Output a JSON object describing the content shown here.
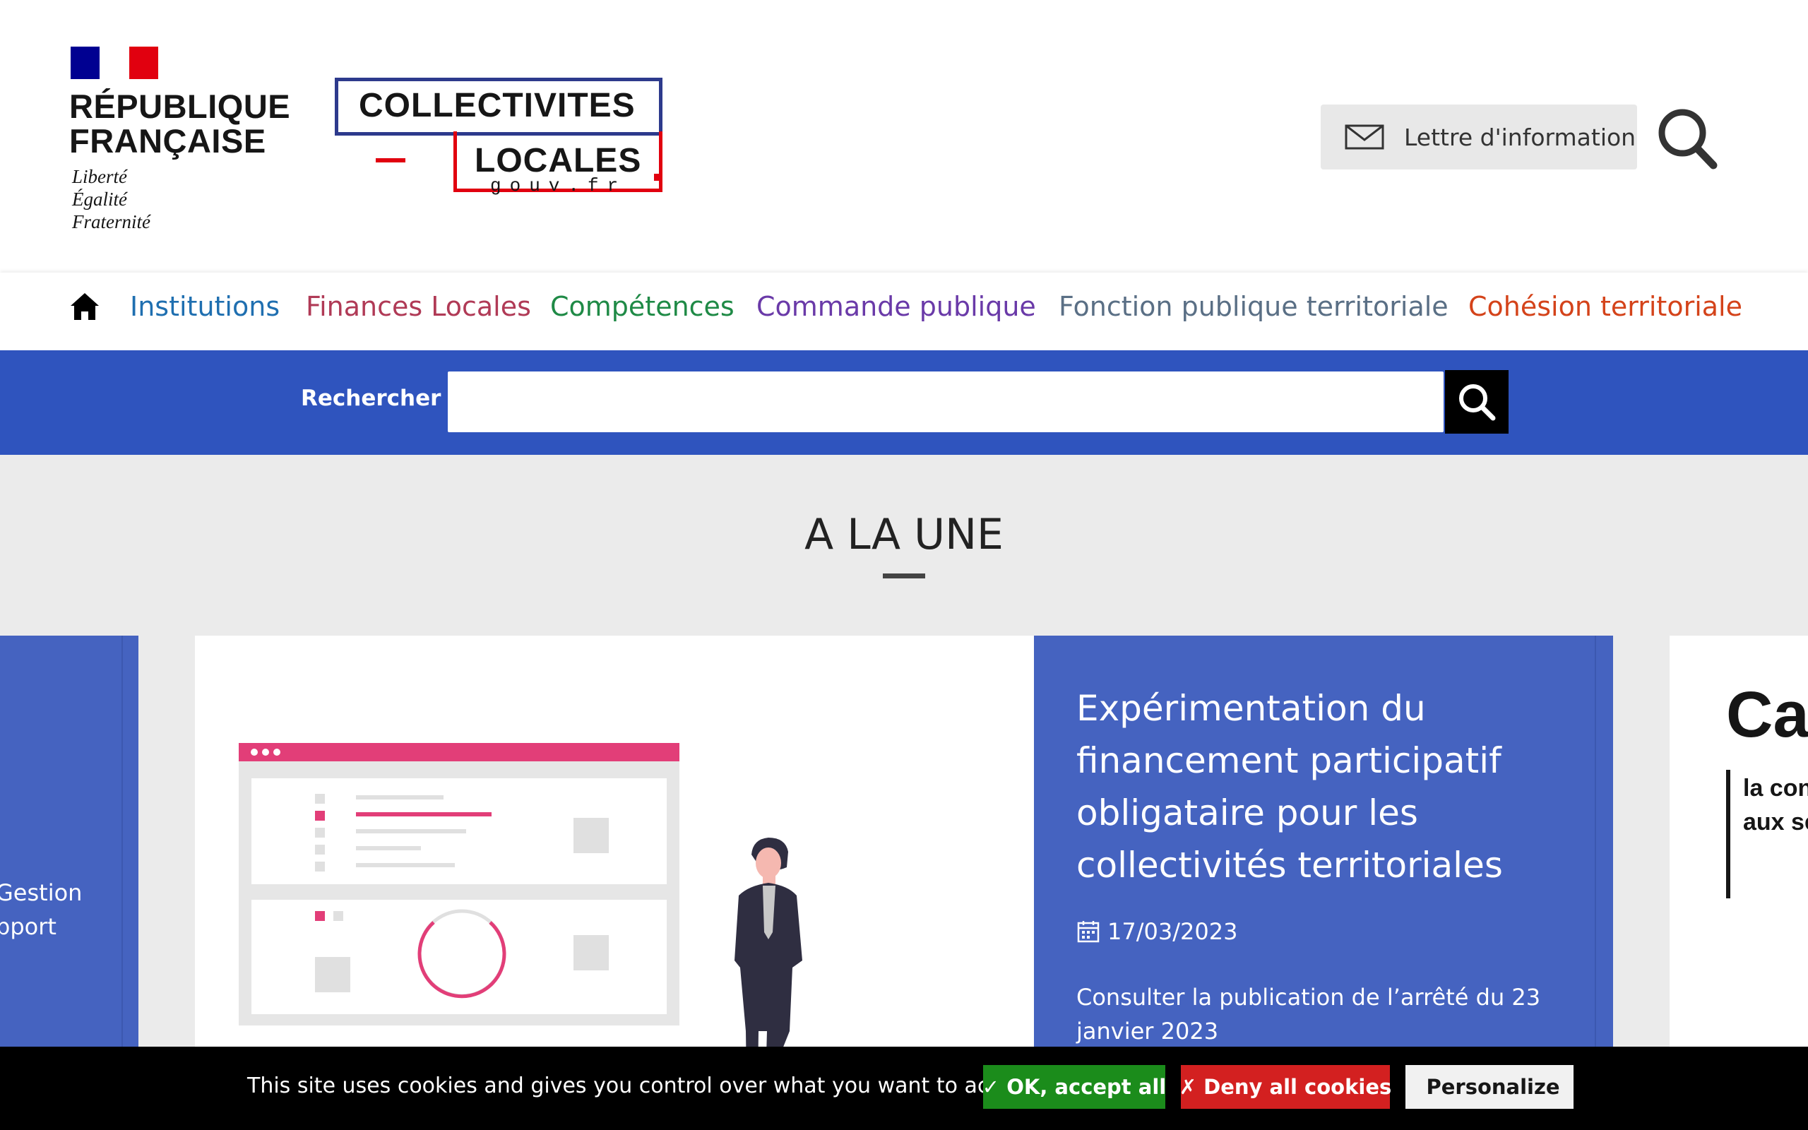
{
  "header": {
    "rf_name_line1": "RÉPUBLIQUE",
    "rf_name_line2": "FRANÇAISE",
    "rf_motto_1": "Liberté",
    "rf_motto_2": "Égalité",
    "rf_motto_3": "Fraternité",
    "site_logo_line1": "COLLECTIVITES",
    "site_logo_line2": "LOCALES",
    "site_logo_sub": "gouv.fr",
    "newsletter_label": "Lettre d'information",
    "icons": {
      "newsletter": "envelope-icon",
      "search": "search-icon"
    }
  },
  "nav": {
    "home_icon": "home-icon",
    "items": [
      {
        "label": "Institutions",
        "color": "#1f6fb0"
      },
      {
        "label": "Finances Locales",
        "color": "#b03a56"
      },
      {
        "label": "Compétences",
        "color": "#1f8a46"
      },
      {
        "label": "Commande publique",
        "color": "#6a3aa8"
      },
      {
        "label": "Fonction publique territoriale",
        "color": "#5a6f85"
      },
      {
        "label": "Cohésion territoriale",
        "color": "#d4431a"
      }
    ]
  },
  "search": {
    "label": "Rechercher",
    "value": "",
    "button_icon": "search-icon"
  },
  "headline": {
    "title": "A LA UNE"
  },
  "carousel": {
    "prev_card_snippet_1": "Gestion",
    "prev_card_snippet_2": "pport",
    "main_card": {
      "title": "Expérimentation du financement participatif obligataire pour les collectivités territoriales",
      "date": "17/03/2023",
      "description": "Consulter la publication de l’arrêté du 23 janvier 2023",
      "date_icon": "calendar-icon"
    },
    "next_card_big": "Ca",
    "next_card_line1": "la con",
    "next_card_line2": "aux se"
  },
  "cookies": {
    "message": "This site uses cookies and gives you control over what you want to activate",
    "accept_label": "✓ OK, accept all",
    "deny_label": "✗ Deny all cookies",
    "personalize_label": "Personalize",
    "personalize_icon": "gear-icon"
  },
  "colors": {
    "band_blue": "#2f54be",
    "card_blue": "#4563c0",
    "accept_green": "#1b8c1b",
    "deny_red": "#d32020"
  }
}
